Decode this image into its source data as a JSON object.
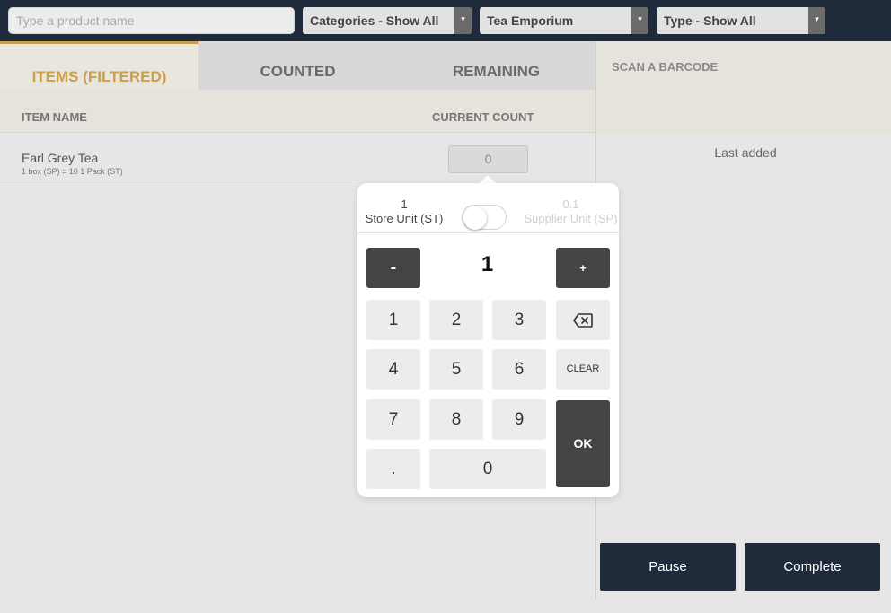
{
  "topbar": {
    "search_placeholder": "Type a product name",
    "categories": "Categories - Show All",
    "store": "Tea Emporium",
    "type": "Type - Show All",
    "dropdown_arrow": "▾"
  },
  "tabs": {
    "items_filtered": "ITEMS (FILTERED)",
    "counted": "COUNTED",
    "remaining": "REMAINING"
  },
  "table": {
    "col_item": "ITEM NAME",
    "col_count": "CURRENT COUNT",
    "rows": [
      {
        "name": "Earl Grey Tea",
        "sub": "1 box (SP) = 10 1 Pack (ST)",
        "count": "0"
      }
    ]
  },
  "right": {
    "scan_label": "SCAN A BARCODE",
    "last_added": "Last added",
    "pause": "Pause",
    "complete": "Complete"
  },
  "keypad": {
    "left_unit_value": "1",
    "left_unit_label": "Store Unit (ST)",
    "right_unit_value": "0.1",
    "right_unit_label": "Supplier Unit (SP)",
    "toggle_on": false,
    "quantity": "1",
    "minus": "-",
    "plus": "+",
    "keys": [
      "1",
      "2",
      "3",
      "4",
      "5",
      "6",
      "7",
      "8",
      "9",
      ".",
      "0"
    ],
    "backspace_icon": "backspace-icon",
    "clear": "CLEAR",
    "ok": "OK"
  }
}
